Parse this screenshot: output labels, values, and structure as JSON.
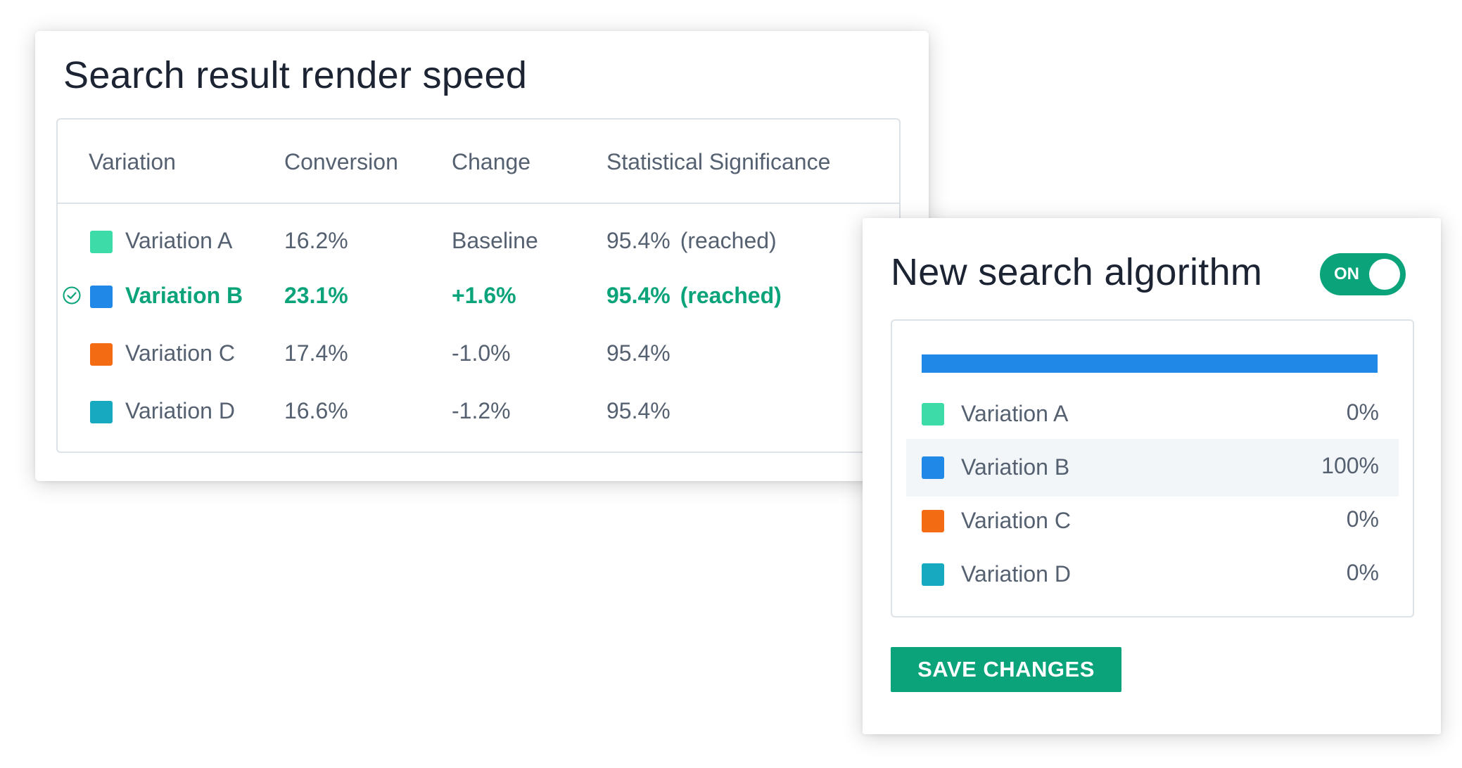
{
  "results": {
    "title": "Search result render speed",
    "columns": [
      "Variation",
      "Conversion",
      "Change",
      "Statistical Significance"
    ],
    "rows": [
      {
        "name": "Variation A",
        "conversion": "16.2%",
        "change": "Baseline",
        "significance": "95.4%",
        "status": "(reached)",
        "color": "#3ddba8",
        "winner": false
      },
      {
        "name": "Variation B",
        "conversion": "23.1%",
        "change": "+1.6%",
        "significance": "95.4%",
        "status": "(reached)",
        "color": "#2088e6",
        "winner": true
      },
      {
        "name": "Variation C",
        "conversion": "17.4%",
        "change": "-1.0%",
        "significance": "95.4%",
        "status": "",
        "color": "#f36b12",
        "winner": false
      },
      {
        "name": "Variation D",
        "conversion": "16.6%",
        "change": "-1.2%",
        "significance": "95.4%",
        "status": "",
        "color": "#17a9bf",
        "winner": false
      }
    ],
    "winner_icon": "check-circle-icon",
    "winner_color": "#0aa37a"
  },
  "control": {
    "title": "New search algorithm",
    "toggle_label": "ON",
    "toggle_on": true,
    "allocation_bar_percent": 100,
    "allocation_bar_color": "#2088e6",
    "allocations": [
      {
        "name": "Variation A",
        "percent": "0%",
        "color": "#3ddba8",
        "highlighted": false
      },
      {
        "name": "Variation B",
        "percent": "100%",
        "color": "#2088e6",
        "highlighted": true
      },
      {
        "name": "Variation C",
        "percent": "0%",
        "color": "#f36b12",
        "highlighted": false
      },
      {
        "name": "Variation D",
        "percent": "0%",
        "color": "#17a9bf",
        "highlighted": false
      }
    ],
    "save_label": "SAVE CHANGES"
  },
  "theme": {
    "accent": "#0aa37a",
    "border": "#dde2e7",
    "text_muted": "#556070",
    "text_dark": "#1c2433"
  }
}
